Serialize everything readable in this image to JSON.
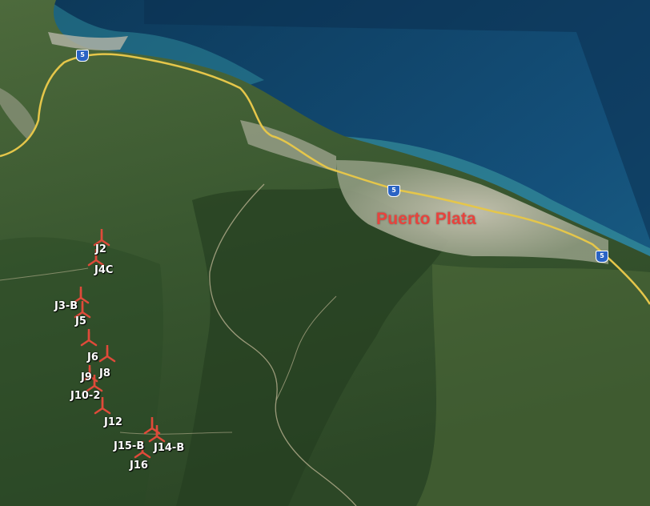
{
  "map": {
    "city": "Puerto Plata",
    "highway_shield": "5",
    "turbines": [
      {
        "label": "J2"
      },
      {
        "label": "J4C"
      },
      {
        "label": "J3-B"
      },
      {
        "label": "J5"
      },
      {
        "label": "J6"
      },
      {
        "label": "J8"
      },
      {
        "label": "J9"
      },
      {
        "label": "J10-2"
      },
      {
        "label": "J12"
      },
      {
        "label": "J15-B"
      },
      {
        "label": "J14-B"
      },
      {
        "label": "J16"
      }
    ],
    "colors": {
      "sea_deep": "#0f3f63",
      "sea_shallow": "#2f8fa0",
      "land": "#3b5a32",
      "urban": "#b9b7a9",
      "highway": "#e5c64a",
      "turbine": "#e04a3a",
      "label_city": "#e8433d"
    }
  }
}
